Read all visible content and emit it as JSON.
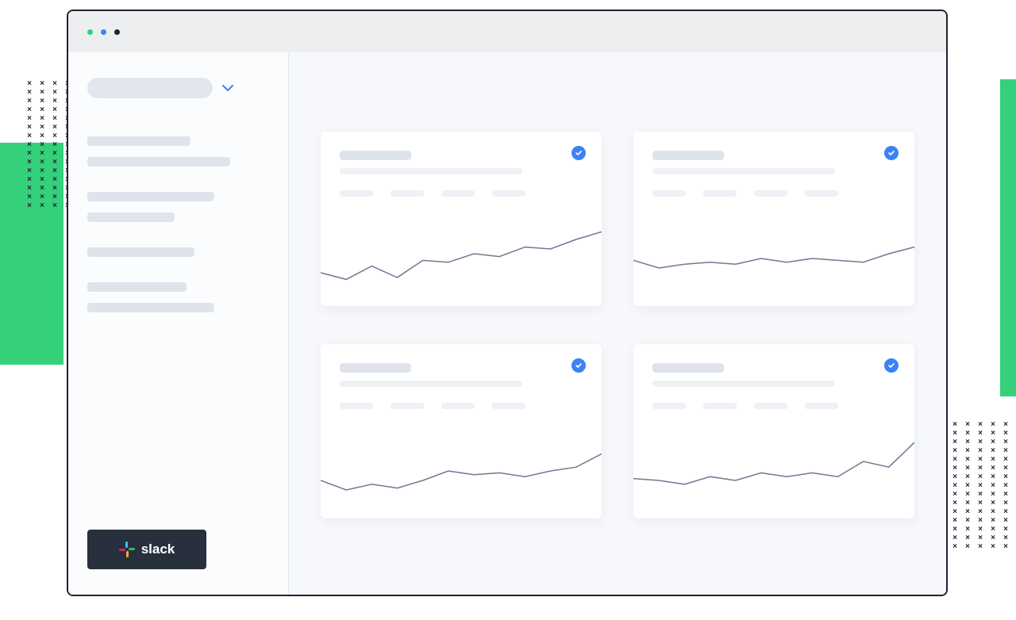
{
  "window": {
    "dots": [
      "green",
      "blue",
      "dark"
    ]
  },
  "sidebar": {
    "workspace_placeholder": "",
    "nav_groups": [
      [
        "",
        ""
      ],
      [
        "",
        ""
      ],
      [
        ""
      ],
      [
        "",
        ""
      ]
    ],
    "slack_label": "slack"
  },
  "cards": [
    {
      "title": "",
      "subtitle": "",
      "metrics": [
        "",
        "",
        "",
        ""
      ],
      "checked": true
    },
    {
      "title": "",
      "subtitle": "",
      "metrics": [
        "",
        "",
        "",
        ""
      ],
      "checked": true
    },
    {
      "title": "",
      "subtitle": "",
      "metrics": [
        "",
        "",
        "",
        ""
      ],
      "checked": true
    },
    {
      "title": "",
      "subtitle": "",
      "metrics": [
        "",
        "",
        "",
        ""
      ],
      "checked": true
    }
  ],
  "chart_data": [
    {
      "type": "line",
      "card": 0,
      "x": [
        0,
        1,
        2,
        3,
        4,
        5,
        6,
        7,
        8,
        9,
        10,
        11
      ],
      "values": [
        35,
        28,
        42,
        30,
        48,
        46,
        55,
        52,
        62,
        60,
        70,
        78
      ],
      "ylim": [
        0,
        100
      ]
    },
    {
      "type": "line",
      "card": 1,
      "x": [
        0,
        1,
        2,
        3,
        4,
        5,
        6,
        7,
        8,
        9,
        10,
        11
      ],
      "values": [
        48,
        40,
        44,
        46,
        44,
        50,
        46,
        50,
        48,
        46,
        55,
        62
      ],
      "ylim": [
        0,
        100
      ]
    },
    {
      "type": "line",
      "card": 2,
      "x": [
        0,
        1,
        2,
        3,
        4,
        5,
        6,
        7,
        8,
        9,
        10,
        11
      ],
      "values": [
        40,
        30,
        36,
        32,
        40,
        50,
        46,
        48,
        44,
        50,
        54,
        68
      ],
      "ylim": [
        0,
        100
      ]
    },
    {
      "type": "line",
      "card": 3,
      "x": [
        0,
        1,
        2,
        3,
        4,
        5,
        6,
        7,
        8,
        9,
        10,
        11
      ],
      "values": [
        42,
        40,
        36,
        44,
        40,
        48,
        44,
        48,
        44,
        60,
        54,
        80
      ],
      "ylim": [
        0,
        100
      ]
    }
  ],
  "colors": {
    "accent": "#3b82f6",
    "green": "#34d17a",
    "line": "#6b7b93"
  }
}
